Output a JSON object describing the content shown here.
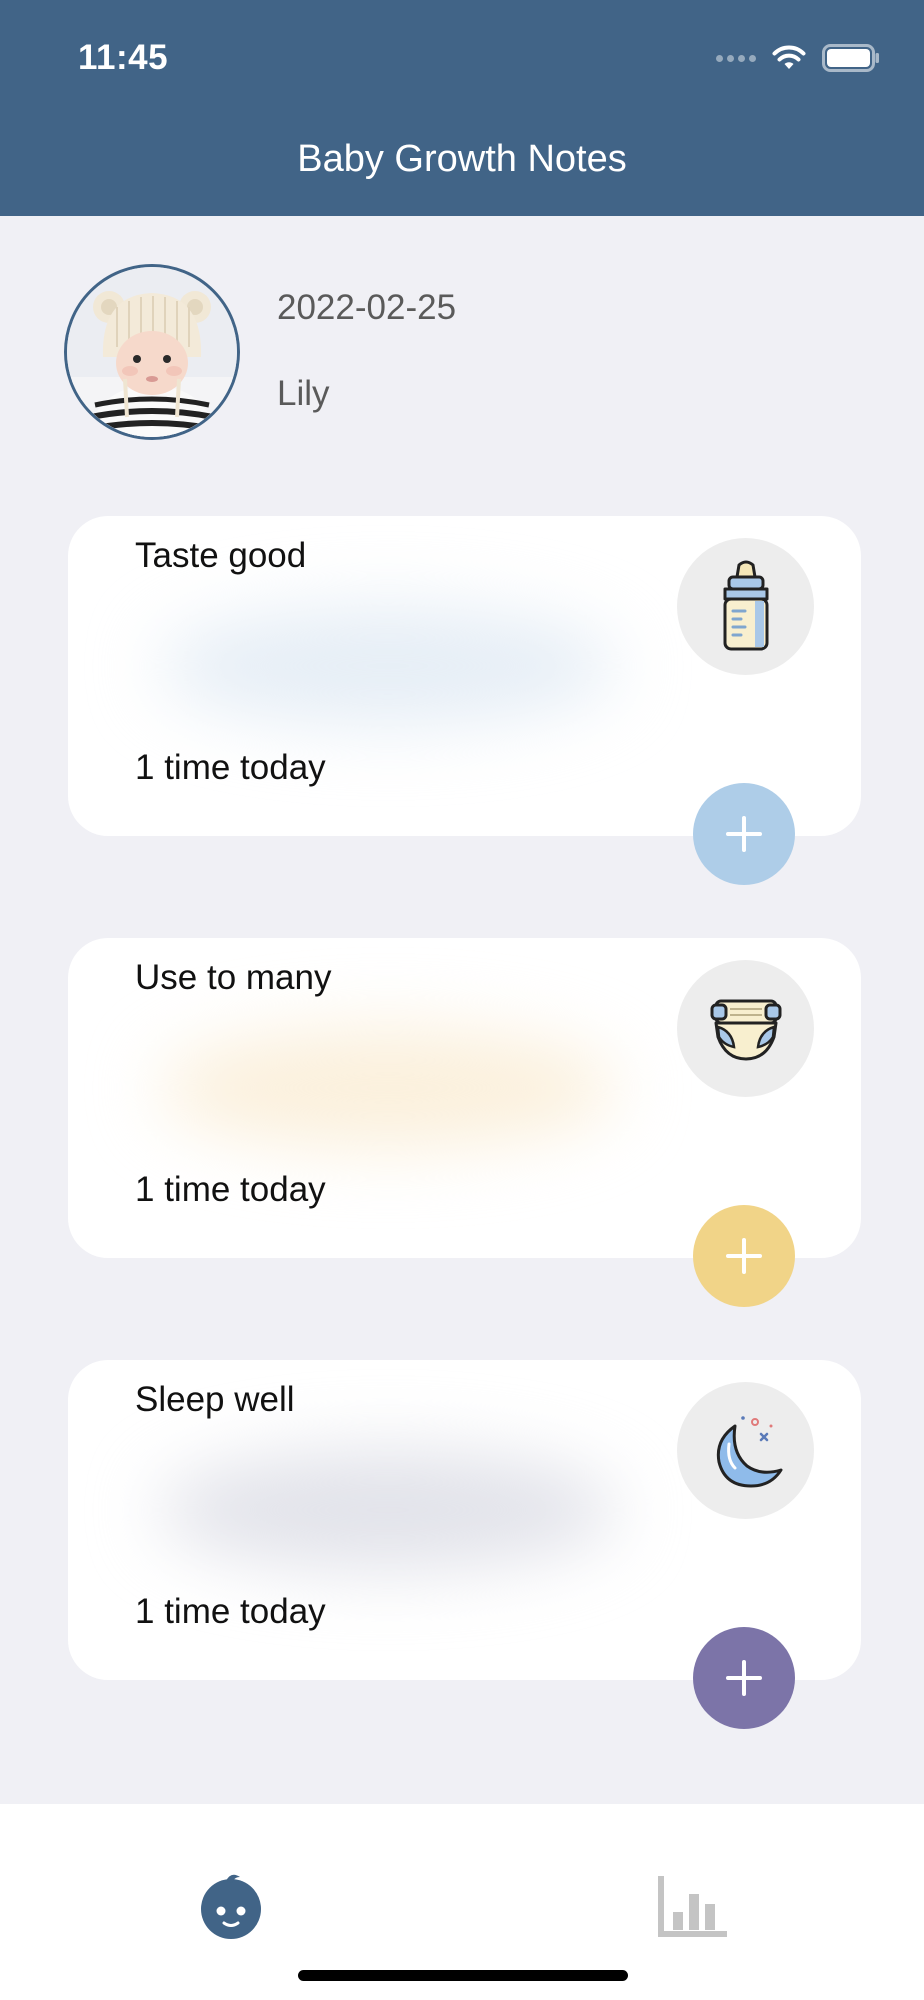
{
  "status_bar": {
    "time": "11:45"
  },
  "header": {
    "title": "Baby Growth Notes"
  },
  "profile": {
    "date": "2022-02-25",
    "name": "Lily"
  },
  "cards": [
    {
      "title": "Taste good",
      "count_text": "1 time today",
      "icon": "baby-bottle-icon",
      "accent": "#aecde8",
      "tint": "#e6eef6"
    },
    {
      "title": "Use to many",
      "count_text": "1 time today",
      "icon": "diaper-icon",
      "accent": "#f1d488",
      "tint": "#fbf0dc"
    },
    {
      "title": "Sleep well",
      "count_text": "1 time today",
      "icon": "moon-icon",
      "accent": "#7c74a8",
      "tint": "#e2e3ea"
    }
  ],
  "tabs": [
    {
      "icon": "baby-face-icon",
      "active": true,
      "color": "#416487"
    },
    {
      "icon": "bar-chart-icon",
      "active": false,
      "color": "#c4c4c4"
    }
  ],
  "colors": {
    "header": "#416487",
    "background": "#f0f0f5"
  }
}
